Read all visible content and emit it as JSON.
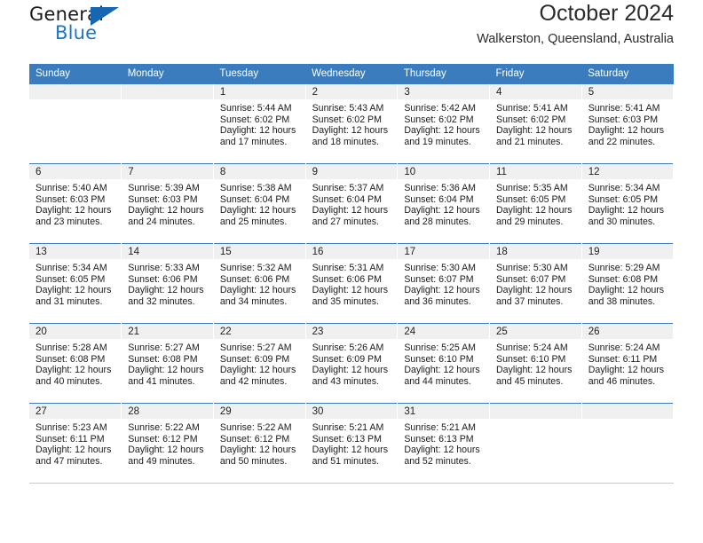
{
  "logo": {
    "word1": "General",
    "word2": "Blue",
    "triangle_color": "#1567b2",
    "blue_color": "#1b76c7"
  },
  "header": {
    "title": "October 2024",
    "subtitle": "Walkerston, Queensland, Australia"
  },
  "theme": {
    "header_bg": "#3a7cbe",
    "daynum_bg": "#f0f0f0",
    "week_divider": "#3a7cbe"
  },
  "weekday_headers": [
    "Sunday",
    "Monday",
    "Tuesday",
    "Wednesday",
    "Thursday",
    "Friday",
    "Saturday"
  ],
  "weeks": [
    [
      {
        "day": "",
        "lines": []
      },
      {
        "day": "",
        "lines": []
      },
      {
        "day": "1",
        "lines": [
          "Sunrise: 5:44 AM",
          "Sunset: 6:02 PM",
          "Daylight: 12 hours",
          "and 17 minutes."
        ]
      },
      {
        "day": "2",
        "lines": [
          "Sunrise: 5:43 AM",
          "Sunset: 6:02 PM",
          "Daylight: 12 hours",
          "and 18 minutes."
        ]
      },
      {
        "day": "3",
        "lines": [
          "Sunrise: 5:42 AM",
          "Sunset: 6:02 PM",
          "Daylight: 12 hours",
          "and 19 minutes."
        ]
      },
      {
        "day": "4",
        "lines": [
          "Sunrise: 5:41 AM",
          "Sunset: 6:02 PM",
          "Daylight: 12 hours",
          "and 21 minutes."
        ]
      },
      {
        "day": "5",
        "lines": [
          "Sunrise: 5:41 AM",
          "Sunset: 6:03 PM",
          "Daylight: 12 hours",
          "and 22 minutes."
        ]
      }
    ],
    [
      {
        "day": "6",
        "lines": [
          "Sunrise: 5:40 AM",
          "Sunset: 6:03 PM",
          "Daylight: 12 hours",
          "and 23 minutes."
        ]
      },
      {
        "day": "7",
        "lines": [
          "Sunrise: 5:39 AM",
          "Sunset: 6:03 PM",
          "Daylight: 12 hours",
          "and 24 minutes."
        ]
      },
      {
        "day": "8",
        "lines": [
          "Sunrise: 5:38 AM",
          "Sunset: 6:04 PM",
          "Daylight: 12 hours",
          "and 25 minutes."
        ]
      },
      {
        "day": "9",
        "lines": [
          "Sunrise: 5:37 AM",
          "Sunset: 6:04 PM",
          "Daylight: 12 hours",
          "and 27 minutes."
        ]
      },
      {
        "day": "10",
        "lines": [
          "Sunrise: 5:36 AM",
          "Sunset: 6:04 PM",
          "Daylight: 12 hours",
          "and 28 minutes."
        ]
      },
      {
        "day": "11",
        "lines": [
          "Sunrise: 5:35 AM",
          "Sunset: 6:05 PM",
          "Daylight: 12 hours",
          "and 29 minutes."
        ]
      },
      {
        "day": "12",
        "lines": [
          "Sunrise: 5:34 AM",
          "Sunset: 6:05 PM",
          "Daylight: 12 hours",
          "and 30 minutes."
        ]
      }
    ],
    [
      {
        "day": "13",
        "lines": [
          "Sunrise: 5:34 AM",
          "Sunset: 6:05 PM",
          "Daylight: 12 hours",
          "and 31 minutes."
        ]
      },
      {
        "day": "14",
        "lines": [
          "Sunrise: 5:33 AM",
          "Sunset: 6:06 PM",
          "Daylight: 12 hours",
          "and 32 minutes."
        ]
      },
      {
        "day": "15",
        "lines": [
          "Sunrise: 5:32 AM",
          "Sunset: 6:06 PM",
          "Daylight: 12 hours",
          "and 34 minutes."
        ]
      },
      {
        "day": "16",
        "lines": [
          "Sunrise: 5:31 AM",
          "Sunset: 6:06 PM",
          "Daylight: 12 hours",
          "and 35 minutes."
        ]
      },
      {
        "day": "17",
        "lines": [
          "Sunrise: 5:30 AM",
          "Sunset: 6:07 PM",
          "Daylight: 12 hours",
          "and 36 minutes."
        ]
      },
      {
        "day": "18",
        "lines": [
          "Sunrise: 5:30 AM",
          "Sunset: 6:07 PM",
          "Daylight: 12 hours",
          "and 37 minutes."
        ]
      },
      {
        "day": "19",
        "lines": [
          "Sunrise: 5:29 AM",
          "Sunset: 6:08 PM",
          "Daylight: 12 hours",
          "and 38 minutes."
        ]
      }
    ],
    [
      {
        "day": "20",
        "lines": [
          "Sunrise: 5:28 AM",
          "Sunset: 6:08 PM",
          "Daylight: 12 hours",
          "and 40 minutes."
        ]
      },
      {
        "day": "21",
        "lines": [
          "Sunrise: 5:27 AM",
          "Sunset: 6:08 PM",
          "Daylight: 12 hours",
          "and 41 minutes."
        ]
      },
      {
        "day": "22",
        "lines": [
          "Sunrise: 5:27 AM",
          "Sunset: 6:09 PM",
          "Daylight: 12 hours",
          "and 42 minutes."
        ]
      },
      {
        "day": "23",
        "lines": [
          "Sunrise: 5:26 AM",
          "Sunset: 6:09 PM",
          "Daylight: 12 hours",
          "and 43 minutes."
        ]
      },
      {
        "day": "24",
        "lines": [
          "Sunrise: 5:25 AM",
          "Sunset: 6:10 PM",
          "Daylight: 12 hours",
          "and 44 minutes."
        ]
      },
      {
        "day": "25",
        "lines": [
          "Sunrise: 5:24 AM",
          "Sunset: 6:10 PM",
          "Daylight: 12 hours",
          "and 45 minutes."
        ]
      },
      {
        "day": "26",
        "lines": [
          "Sunrise: 5:24 AM",
          "Sunset: 6:11 PM",
          "Daylight: 12 hours",
          "and 46 minutes."
        ]
      }
    ],
    [
      {
        "day": "27",
        "lines": [
          "Sunrise: 5:23 AM",
          "Sunset: 6:11 PM",
          "Daylight: 12 hours",
          "and 47 minutes."
        ]
      },
      {
        "day": "28",
        "lines": [
          "Sunrise: 5:22 AM",
          "Sunset: 6:12 PM",
          "Daylight: 12 hours",
          "and 49 minutes."
        ]
      },
      {
        "day": "29",
        "lines": [
          "Sunrise: 5:22 AM",
          "Sunset: 6:12 PM",
          "Daylight: 12 hours",
          "and 50 minutes."
        ]
      },
      {
        "day": "30",
        "lines": [
          "Sunrise: 5:21 AM",
          "Sunset: 6:13 PM",
          "Daylight: 12 hours",
          "and 51 minutes."
        ]
      },
      {
        "day": "31",
        "lines": [
          "Sunrise: 5:21 AM",
          "Sunset: 6:13 PM",
          "Daylight: 12 hours",
          "and 52 minutes."
        ]
      },
      {
        "day": "",
        "lines": []
      },
      {
        "day": "",
        "lines": []
      }
    ]
  ]
}
